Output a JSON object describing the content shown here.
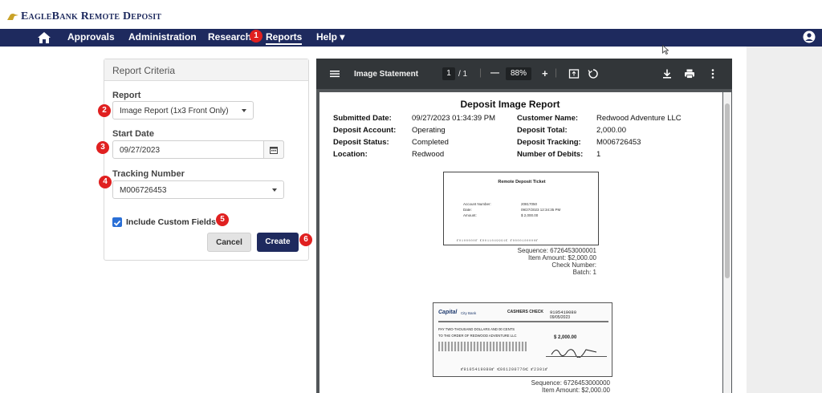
{
  "app": {
    "brand_text": "EagleBank Remote Deposit"
  },
  "nav": {
    "items": [
      {
        "label": "Approvals"
      },
      {
        "label": "Administration"
      },
      {
        "label": "Research"
      },
      {
        "label": "Reports"
      },
      {
        "label": "Help ▾"
      }
    ]
  },
  "criteria": {
    "title": "Report Criteria",
    "report_label": "Report",
    "report_value": "Image Report (1x3 Front Only)",
    "start_label": "Start Date",
    "start_value": "09/27/2023",
    "tracking_label": "Tracking Number",
    "tracking_value": "M006726453",
    "custom_fields_label": "Include Custom Fields",
    "custom_fields_checked": true,
    "cancel": "Cancel",
    "create": "Create"
  },
  "markers": [
    "1",
    "2",
    "3",
    "4",
    "5",
    "6"
  ],
  "viewer": {
    "title": "Image Statement",
    "page_current": "1",
    "page_total": "/ 1",
    "zoom": "88%",
    "zoom_out": "—",
    "zoom_in": "+"
  },
  "doc": {
    "title": "Deposit Image Report",
    "fields": {
      "submitted_label": "Submitted Date:",
      "submitted_value": "09/27/2023 01:34:39 PM",
      "account_label": "Deposit Account:",
      "account_value": "Operating",
      "status_label": "Deposit Status:",
      "status_value": "Completed",
      "location_label": "Location:",
      "location_value": "Redwood",
      "customer_label": "Customer Name:",
      "customer_value": "Redwood Adventure LLC",
      "total_label": "Deposit Total:",
      "total_value": "2,000.00",
      "tracking_label": "Deposit Tracking:",
      "tracking_value": "M006726453",
      "debits_label": "Number of Debits:",
      "debits_value": "1"
    },
    "ticket": {
      "title": "Remote Deposit Ticket",
      "acct_label": "Account Number:",
      "acct_value": "20817050",
      "date_label": "Date:",
      "date_value": "09/27/2023 12:34:35 PM",
      "amount_label": "Amount:",
      "amount_value": "$ 2,000.00",
      "micr": "⑈0100000⑈   ⑆0011049991⑆   ⑈0000100000⑈"
    },
    "item1": {
      "sequence": "Sequence: 6726453000001",
      "amount": "Item Amount: $2,000.00",
      "check_number": "Check Number:",
      "batch": "Batch: 1"
    },
    "check": {
      "bank": "Capital",
      "bank_suffix": "City Bank",
      "type": "CASHIERS CHECK",
      "number": "9105419080",
      "date": "09/05/2023",
      "payee_line": "PAY TWO-THOUSAND DOLLARS AND 00 CENTS",
      "order_line": "TO THE ORDER OF  REDWOOD ADVENTURE LLC",
      "amount": "$ 2,000.00",
      "micr": "⑈9105419080⑈  ⑆061200776⑆  ⑈2301⑈"
    },
    "item2": {
      "sequence": "Sequence: 6726453000000",
      "amount": "Item Amount: $2,000.00"
    }
  }
}
